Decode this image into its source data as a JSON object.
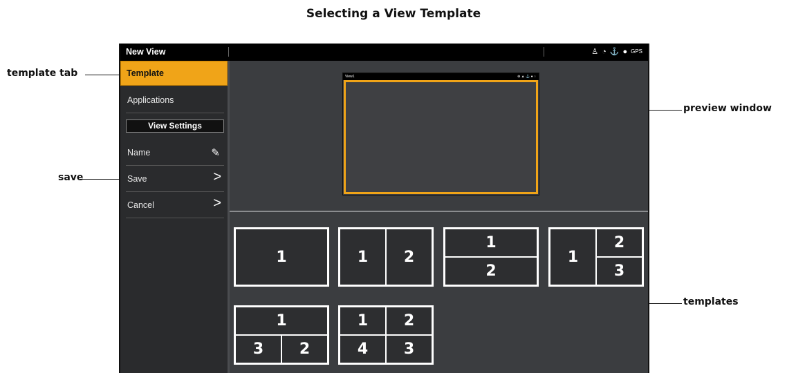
{
  "page": {
    "title": "Selecting a View Template"
  },
  "callouts": {
    "template_tab": "template tab",
    "save": "save",
    "preview_window": "preview window",
    "templates": "templates"
  },
  "device": {
    "window_title": "New View",
    "status_icons": [
      "person-icon",
      "sonar-icon",
      "anchor-icon",
      "navigation-icon",
      "gps-icon"
    ],
    "status_glyphs": [
      "♙",
      "◔",
      "⚓",
      "●",
      "GPS"
    ],
    "accent_color": "#f0a418"
  },
  "sidebar": {
    "tab_template": "Template",
    "applications": "Applications",
    "view_settings_header": "View Settings",
    "name": "Name",
    "save": "Save",
    "cancel": "Cancel",
    "chevron": ">",
    "edit_glyph": "✎"
  },
  "preview": {
    "title": "View1",
    "icons": "⊕ ▲ ⚓ ● ◌"
  },
  "templates": [
    {
      "cells": [
        "1"
      ]
    },
    {
      "cells": [
        "1",
        "2"
      ]
    },
    {
      "cells": [
        "1",
        "2"
      ]
    },
    {
      "cells": [
        "1",
        "2",
        "3"
      ]
    },
    {
      "cells": [
        "1",
        "3",
        "2"
      ]
    },
    {
      "cells": [
        "1",
        "2",
        "4",
        "3"
      ]
    }
  ]
}
